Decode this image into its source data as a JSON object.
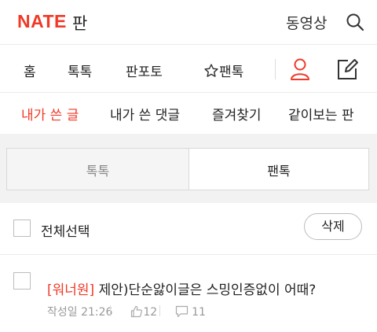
{
  "header": {
    "logo": "NATE",
    "logo_sub": "판",
    "video_label": "동영상",
    "search_icon": "search-icon"
  },
  "nav": {
    "items": [
      "홈",
      "톡톡",
      "판포토",
      "팬톡"
    ],
    "user_icon": "user-icon",
    "edit_icon": "edit-icon",
    "accent_color": "#ef3a28"
  },
  "subtabs": {
    "items": [
      "내가 쓴 글",
      "내가 쓴 댓글",
      "즐겨찾기",
      "같이보는 판"
    ],
    "active_index": 0
  },
  "segment": {
    "left_label": "톡톡",
    "right_label": "팬톡",
    "selected": "팬톡"
  },
  "select_row": {
    "select_all_label": "전체선택",
    "delete_label": "삭제"
  },
  "posts": [
    {
      "tag": "[워너원]",
      "title": " 제안)단순앓이글은 스밍인증없이 어때?",
      "date": "작성일 21:26",
      "likes": "12",
      "comments": "11"
    }
  ]
}
